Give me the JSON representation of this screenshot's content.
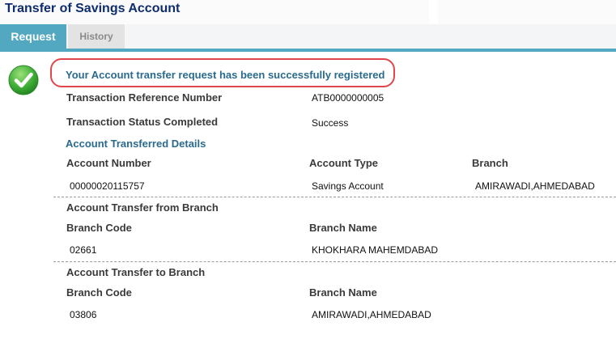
{
  "page": {
    "title": "Transfer of Savings Account"
  },
  "tabs": {
    "request": "Request",
    "history": "History"
  },
  "message": {
    "success": "Your Account transfer request has been successfully registered"
  },
  "transaction": {
    "ref_label": "Transaction Reference Number",
    "ref_value": "ATB0000000005",
    "status_label": "Transaction Status Completed",
    "status_value": "Success"
  },
  "transferred_details": {
    "heading": "Account Transferred Details",
    "col_account_number": "Account Number",
    "col_account_type": "Account Type",
    "col_branch": "Branch",
    "account_number": "00000020115757",
    "account_type": "Savings Account",
    "branch": "AMIRAWADI,AHMEDABAD"
  },
  "from_branch": {
    "heading": "Account Transfer from Branch",
    "code_label": "Branch Code",
    "name_label": "Branch Name",
    "code": "02661",
    "name": "KHOKHARA MAHEMDABAD"
  },
  "to_branch": {
    "heading": "Account Transfer to Branch",
    "code_label": "Branch Code",
    "name_label": "Branch Name",
    "code": "03806",
    "name": "AMIRAWADI,AHMEDABAD"
  },
  "colors": {
    "accent": "#52a7c1",
    "title": "#0f2d6e",
    "heading": "#2a6a8c",
    "highlight": "#e0474c",
    "success": "#3aa33a"
  },
  "icons": {
    "success": "check-circle-icon"
  }
}
